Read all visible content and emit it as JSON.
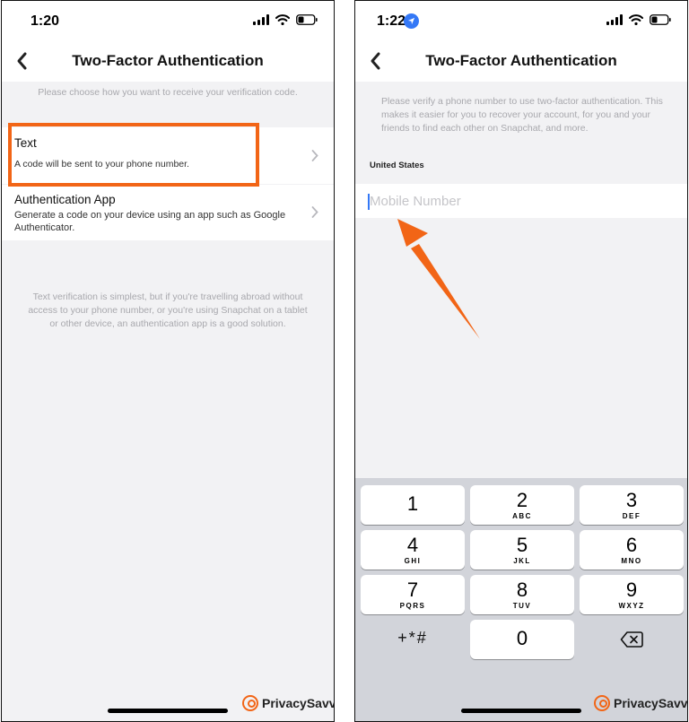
{
  "left_screen": {
    "status_time": "1:20",
    "nav_title": "Two-Factor Authentication",
    "instruction": "Please choose how you want to receive your verification code.",
    "options": [
      {
        "title": "Text",
        "description": "A code will be sent to your phone number."
      },
      {
        "title": "Authentication App",
        "description": "Generate a code on your device using an app such as Google Authenticator."
      }
    ],
    "footer_hint": "Text verification is simplest, but if you're travelling abroad without access to your phone number, or you're using Snapchat on a tablet or other device, an authentication app is a good solution.",
    "brand": "PrivacySavvy"
  },
  "right_screen": {
    "status_time": "1:22",
    "nav_title": "Two-Factor Authentication",
    "instruction": "Please verify a phone number to use two-factor authentication. This makes it easier for you to recover your account, for you and your friends to find each other on Snapchat, and more.",
    "country": "United States",
    "mobile": {
      "value": "",
      "placeholder": "Mobile Number"
    },
    "keypad": {
      "keys": [
        {
          "digit": "1",
          "letters": ""
        },
        {
          "digit": "2",
          "letters": "ABC"
        },
        {
          "digit": "3",
          "letters": "DEF"
        },
        {
          "digit": "4",
          "letters": "GHI"
        },
        {
          "digit": "5",
          "letters": "JKL"
        },
        {
          "digit": "6",
          "letters": "MNO"
        },
        {
          "digit": "7",
          "letters": "PQRS"
        },
        {
          "digit": "8",
          "letters": "TUV"
        },
        {
          "digit": "9",
          "letters": "WXYZ"
        },
        {
          "digit": "0",
          "letters": ""
        }
      ],
      "symbols_label": "+*#"
    },
    "brand": "PrivacySavvy"
  },
  "colors": {
    "highlight": "#f26516",
    "accent": "#3478f6",
    "screen_background": "#f2f2f4",
    "keypad_background": "#d2d4da"
  },
  "icons": [
    "back-chevron-icon",
    "chevron-right-icon",
    "cellular-signal-icon",
    "wifi-icon",
    "battery-icon",
    "location-arrow-icon",
    "delete-key-icon",
    "privacysavvy-logo-icon",
    "arrow-annotation-icon"
  ]
}
